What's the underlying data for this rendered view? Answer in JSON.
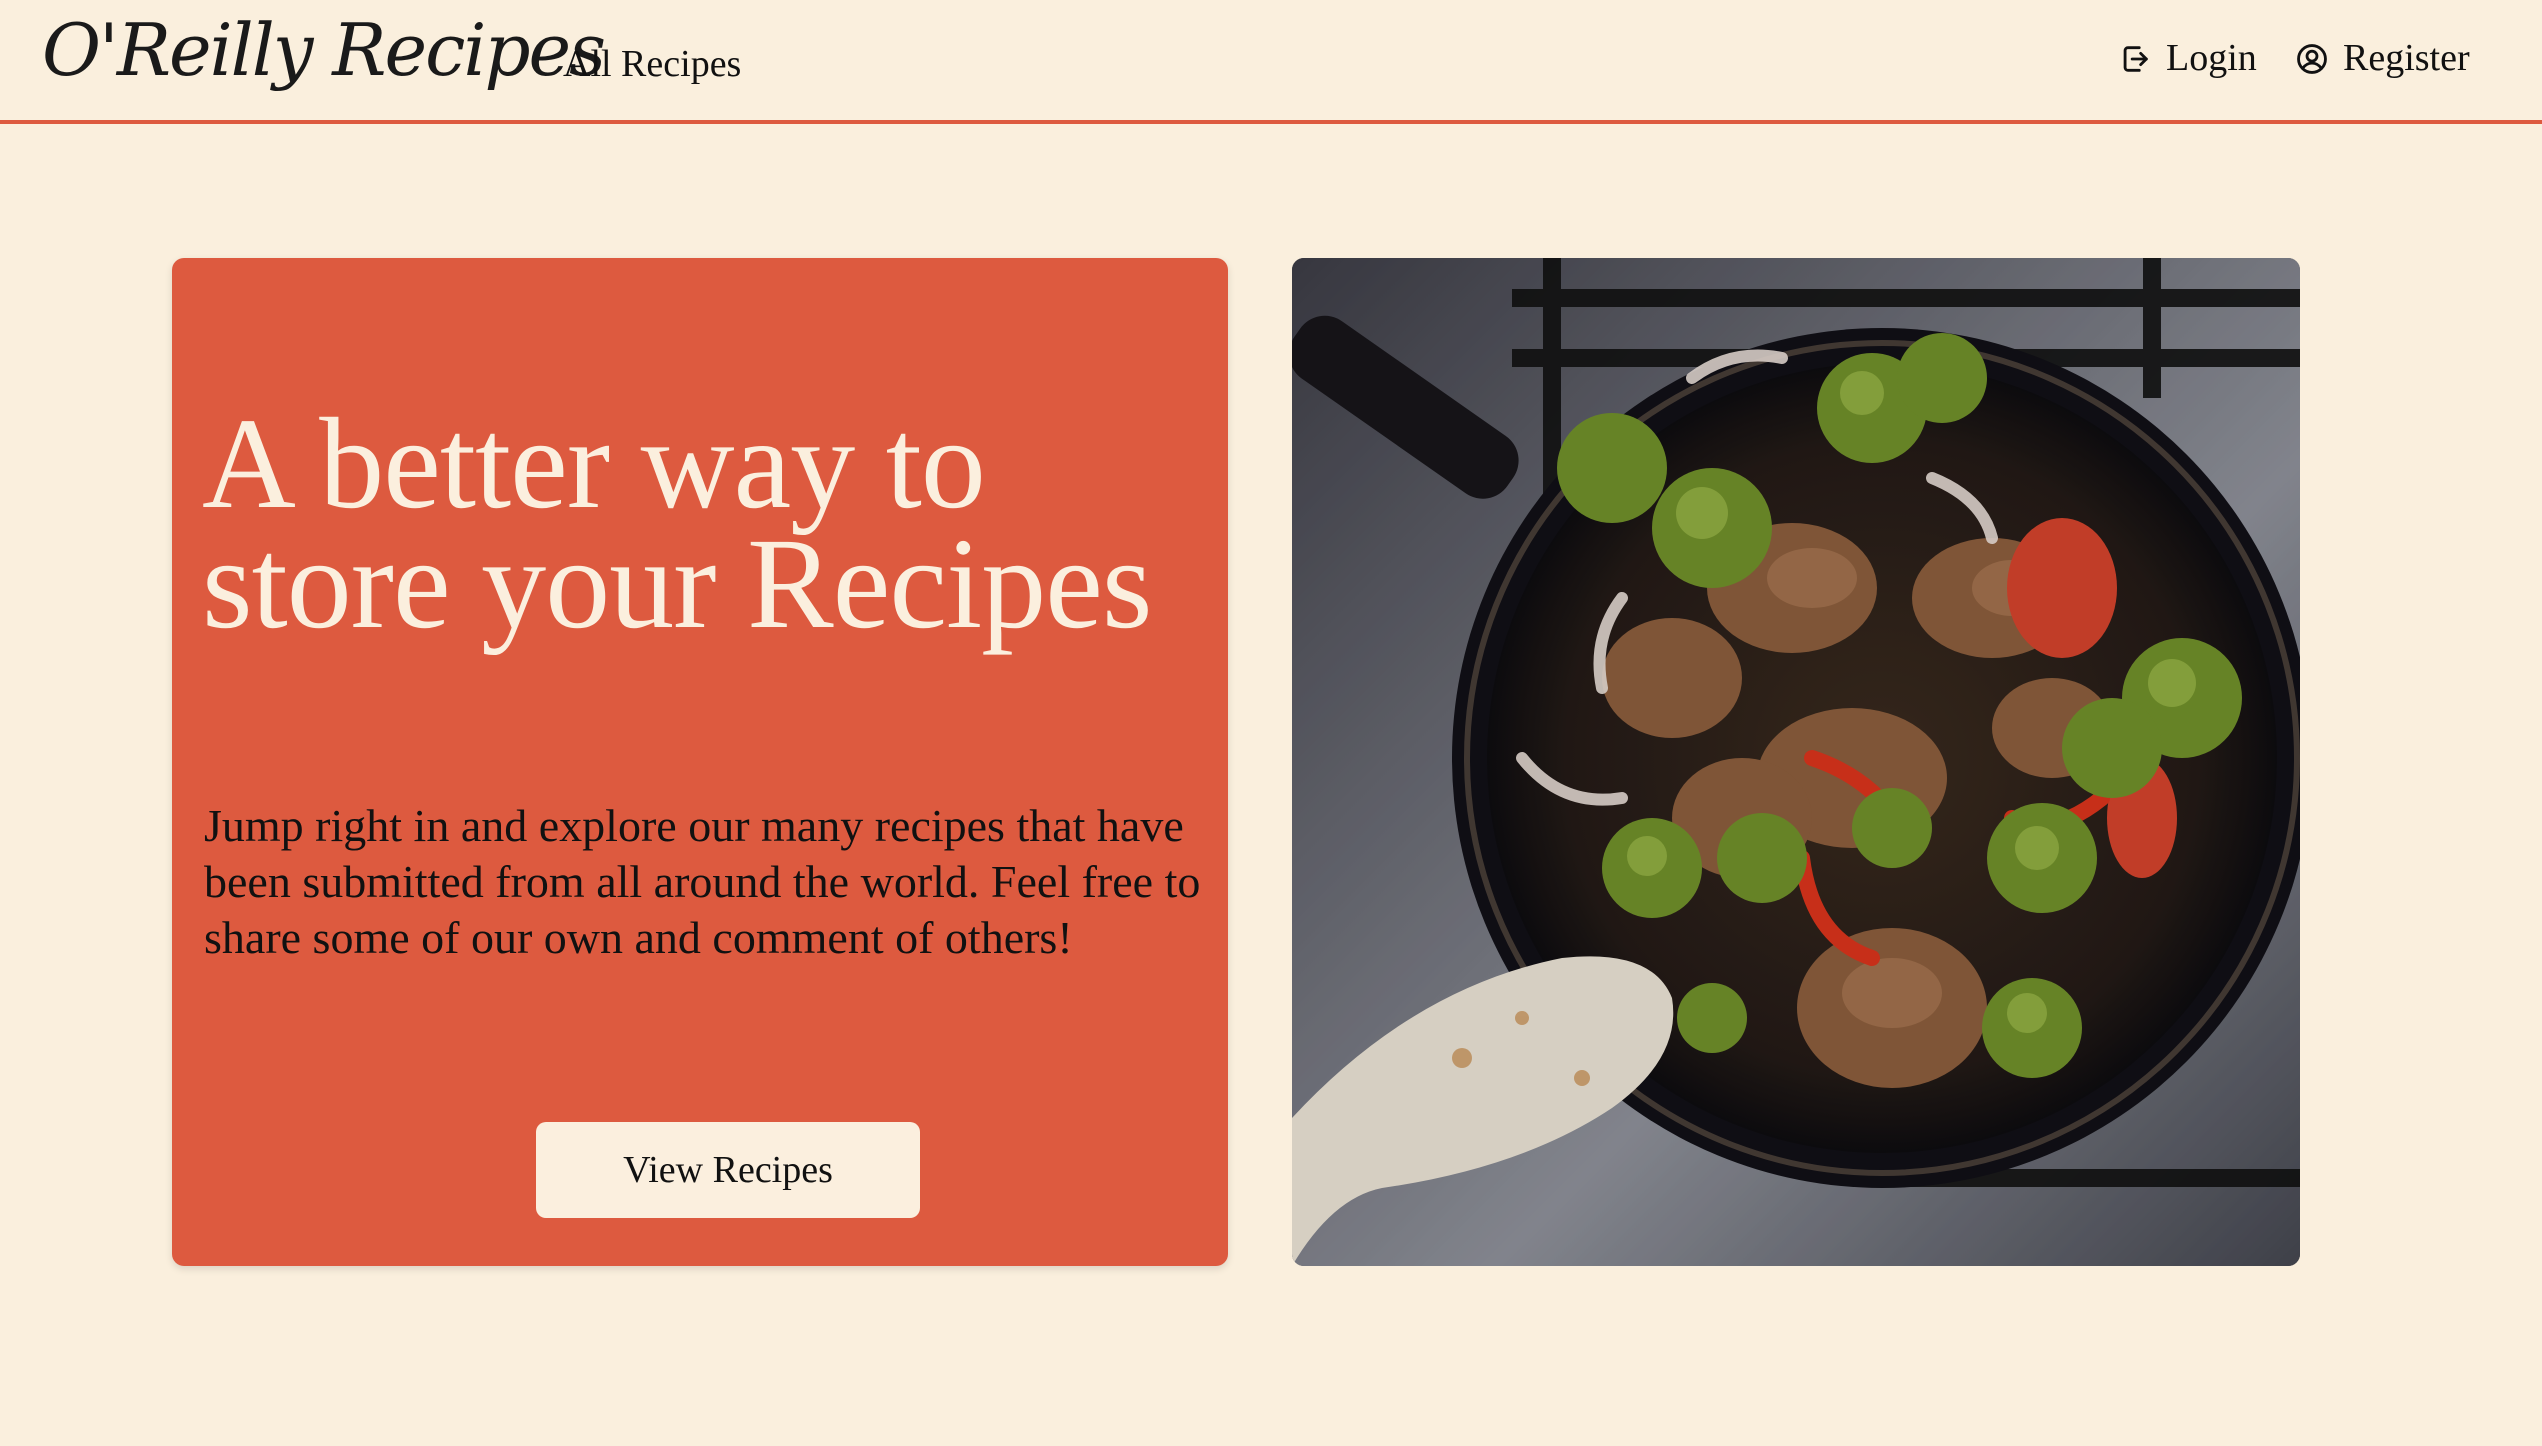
{
  "header": {
    "logo": "O'Reilly Recipes",
    "nav_all_recipes": "All Recipes",
    "login": "Login",
    "register": "Register"
  },
  "hero": {
    "title": "A better way to store your Recipes",
    "text": "Jump right in and explore our many recipes that have been submitted from all around the world. Feel free to share some of our own and comment of others!",
    "button": "View Recipes"
  },
  "colors": {
    "background": "#faefdd",
    "accent": "#dd5a3f",
    "cream": "#fbefde"
  },
  "icons": {
    "login": "login-icon",
    "register": "user-circle-icon"
  }
}
